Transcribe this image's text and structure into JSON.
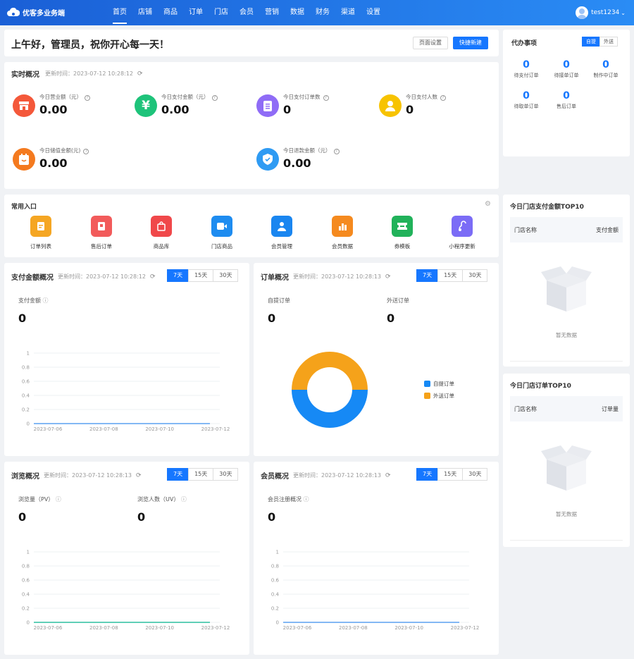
{
  "app": {
    "name": "优客多业务端"
  },
  "nav": [
    "首页",
    "店铺",
    "商品",
    "订单",
    "门店",
    "会员",
    "营销",
    "数据",
    "财务",
    "渠道",
    "设置"
  ],
  "user": {
    "name": "test1234"
  },
  "greeting": {
    "text": "上午好，管理员，祝你开心每一天！",
    "page_settings": "页面设置",
    "quick_new": "快捷新建"
  },
  "realtime": {
    "title": "实时概况",
    "updated": "更新时间：2023-07-12 10:28:12",
    "stats": [
      {
        "label": "今日营业额（元）",
        "value": "0.00",
        "color": "#f4583a",
        "icon": "store-icon"
      },
      {
        "label": "今日支付金额（元）",
        "value": "0.00",
        "color": "#1ec37a",
        "icon": "yen-icon"
      },
      {
        "label": "今日支付订单数",
        "value": "0",
        "color": "#8f6cf6",
        "icon": "document-icon"
      },
      {
        "label": "今日支付人数",
        "value": "0",
        "color": "#f7c300",
        "icon": "user-icon"
      },
      {
        "label": "今日储值金额(元)",
        "value": "0.00",
        "color": "#f47a1f",
        "icon": "wallet-icon"
      },
      {
        "label": "今日退款金额（元）",
        "value": "0.00",
        "color": "#2f9bf3",
        "icon": "shield-icon"
      }
    ]
  },
  "todo": {
    "title": "代办事项",
    "tabs": [
      "自提",
      "外送"
    ],
    "items": [
      {
        "n": "0",
        "label": "待支付订单"
      },
      {
        "n": "0",
        "label": "待接单订单"
      },
      {
        "n": "0",
        "label": "制作中订单"
      },
      {
        "n": "0",
        "label": "待取单订单"
      },
      {
        "n": "0",
        "label": "售后订单"
      }
    ]
  },
  "common": {
    "title": "常用入口",
    "items": [
      {
        "label": "订单列表",
        "color": "#f5a623",
        "icon": "order-list-icon"
      },
      {
        "label": "售后订单",
        "color": "#f25b5b",
        "icon": "aftersale-icon"
      },
      {
        "label": "商品库",
        "color": "#f0484a",
        "icon": "bag-icon"
      },
      {
        "label": "门店商品",
        "color": "#1e8cf0",
        "icon": "video-icon"
      },
      {
        "label": "会员管理",
        "color": "#1a86f0",
        "icon": "members-icon"
      },
      {
        "label": "会员数据",
        "color": "#f58a1f",
        "icon": "chart-icon"
      },
      {
        "label": "券模板",
        "color": "#21b25a",
        "icon": "coupon-icon"
      },
      {
        "label": "小程序更新",
        "color": "#7b6cf6",
        "icon": "link-icon"
      }
    ]
  },
  "ranges": [
    "7天",
    "15天",
    "30天"
  ],
  "pay": {
    "title": "支付金额概况",
    "updated": "更新时间：2023-07-12 10:28:12",
    "metric": "支付金额",
    "value": "0"
  },
  "order": {
    "title": "订单概况",
    "updated": "更新时间：2023-07-12 10:28:13",
    "m1": "自提订单",
    "v1": "0",
    "m2": "外送订单",
    "v2": "0",
    "legend": [
      "自提订单",
      "外送订单"
    ],
    "colors": [
      "#1689f5",
      "#f5a21a"
    ]
  },
  "browse": {
    "title": "浏览概况",
    "updated": "更新时间：2023-07-12 10:28:13",
    "m1": "浏览量（PV）",
    "v1": "0",
    "m2": "浏览人数（UV）",
    "v2": "0"
  },
  "member": {
    "title": "会员概况",
    "updated": "更新时间：2023-07-12 10:28:13",
    "metric": "会员注册概况",
    "value": "0"
  },
  "top_pay": {
    "title": "今日门店支付金额TOP10",
    "col1": "门店名称",
    "col2": "支付金额",
    "empty": "暂无数据"
  },
  "top_order": {
    "title": "今日门店订单TOP10",
    "col1": "门店名称",
    "col2": "订单量",
    "empty": "暂无数据"
  },
  "chart_data": [
    {
      "type": "line",
      "title": "支付金额概况",
      "x": [
        "2023-07-06",
        "2023-07-08",
        "2023-07-10",
        "2023-07-12"
      ],
      "series": [
        {
          "values": [
            0,
            0,
            0,
            0
          ],
          "color": "#5aa0f0"
        }
      ],
      "ylim": [
        0,
        1
      ],
      "yticks": [
        "0",
        "0.2",
        "0.4",
        "0.6",
        "0.8",
        "1"
      ]
    },
    {
      "type": "pie",
      "title": "订单概况",
      "categories": [
        "自提订单",
        "外送订单"
      ],
      "values": [
        0,
        0
      ],
      "colors": [
        "#1689f5",
        "#f5a21a"
      ]
    },
    {
      "type": "line",
      "title": "浏览概况",
      "x": [
        "2023-07-06",
        "2023-07-08",
        "2023-07-10",
        "2023-07-12"
      ],
      "series": [
        {
          "values": [
            0,
            0,
            0,
            0
          ],
          "color": "#2bbf9f"
        }
      ],
      "ylim": [
        0,
        1
      ],
      "yticks": [
        "0",
        "0.2",
        "0.4",
        "0.6",
        "0.8",
        "1"
      ]
    },
    {
      "type": "line",
      "title": "会员概况",
      "x": [
        "2023-07-06",
        "2023-07-08",
        "2023-07-10",
        "2023-07-12"
      ],
      "series": [
        {
          "values": [
            0,
            0,
            0,
            0
          ],
          "color": "#5aa0f0"
        }
      ],
      "ylim": [
        0,
        1
      ],
      "yticks": [
        "0",
        "0.2",
        "0.4",
        "0.6",
        "0.8",
        "1"
      ]
    }
  ]
}
